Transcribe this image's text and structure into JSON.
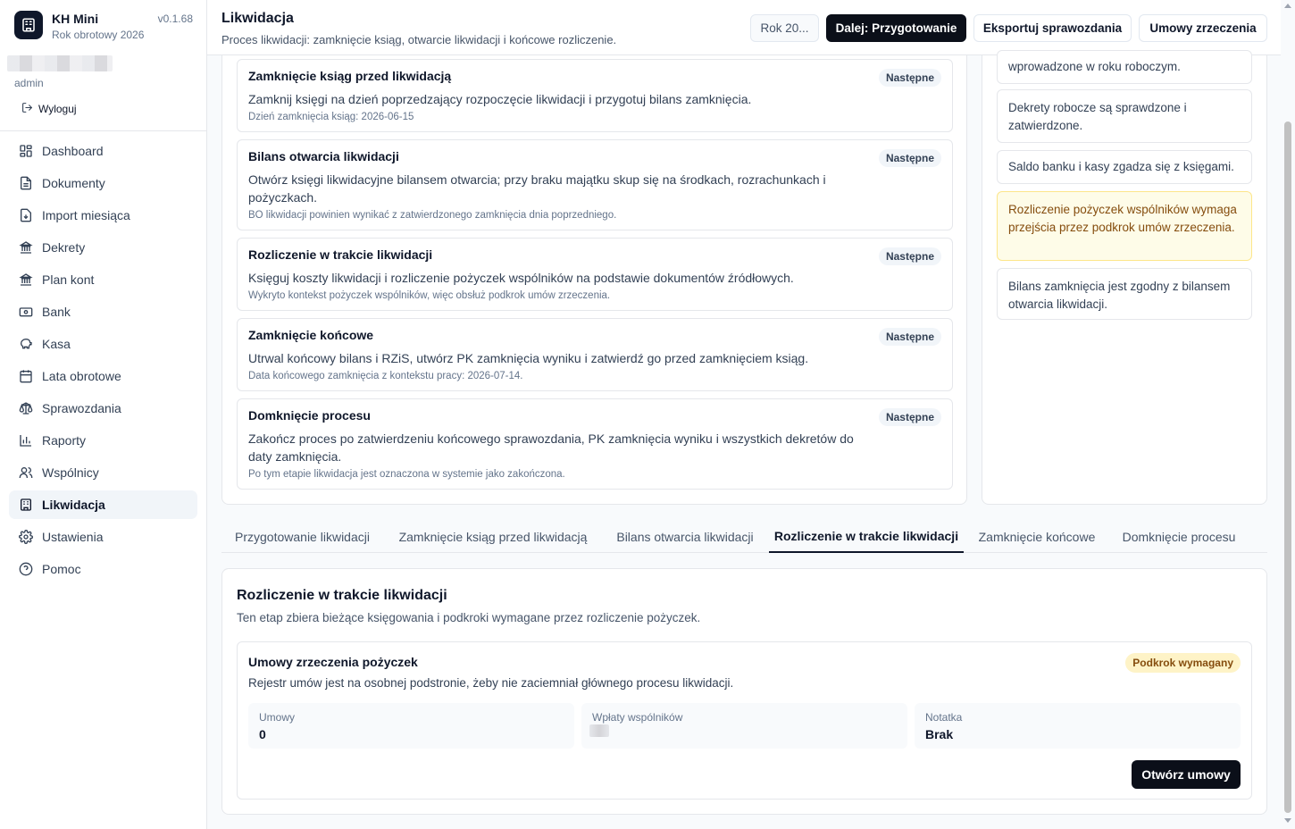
{
  "app": {
    "name": "KH Mini",
    "version": "v0.1.68",
    "fiscal_year": "Rok obrotowy 2026",
    "user_role": "admin",
    "logout_label": "Wyloguj"
  },
  "sidebar": {
    "items": [
      {
        "label": "Dashboard",
        "icon": "dashboard-icon"
      },
      {
        "label": "Dokumenty",
        "icon": "document-icon"
      },
      {
        "label": "Import miesiąca",
        "icon": "import-icon"
      },
      {
        "label": "Dekrety",
        "icon": "bank-building-icon"
      },
      {
        "label": "Plan kont",
        "icon": "bank-building-icon"
      },
      {
        "label": "Bank",
        "icon": "wallet-icon"
      },
      {
        "label": "Kasa",
        "icon": "piggy-bank-icon"
      },
      {
        "label": "Lata obrotowe",
        "icon": "calendar-icon"
      },
      {
        "label": "Sprawozdania",
        "icon": "scale-icon"
      },
      {
        "label": "Raporty",
        "icon": "bar-chart-icon"
      },
      {
        "label": "Wspólnicy",
        "icon": "users-icon"
      },
      {
        "label": "Likwidacja",
        "icon": "building-icon",
        "active": true
      },
      {
        "label": "Ustawienia",
        "icon": "gear-icon"
      },
      {
        "label": "Pomoc",
        "icon": "help-icon"
      }
    ]
  },
  "header": {
    "title": "Likwidacja",
    "subtitle": "Proces likwidacji: zamknięcie ksiąg, otwarcie likwidacji i końcowe rozliczenie.",
    "year_button": "Rok 20...",
    "next_button": "Dalej: Przygotowanie",
    "export_button": "Eksportuj sprawozdania",
    "agreements_button": "Umowy zrzeczenia"
  },
  "steps": [
    {
      "title": "Zamknięcie ksiąg przed likwidacją",
      "badge": "Następne",
      "desc": "Zamknij księgi na dzień poprzedzający rozpoczęcie likwidacji i przygotuj bilans zamknięcia.",
      "note": "Dzień zamknięcia ksiąg: 2026-06-15"
    },
    {
      "title": "Bilans otwarcia likwidacji",
      "badge": "Następne",
      "desc": "Otwórz księgi likwidacyjne bilansem otwarcia; przy braku majątku skup się na środkach, rozrachunkach i pożyczkach.",
      "note": "BO likwidacji powinien wynikać z zatwierdzonego zamknięcia dnia poprzedniego."
    },
    {
      "title": "Rozliczenie w trakcie likwidacji",
      "badge": "Następne",
      "desc": "Księguj koszty likwidacji i rozliczenie pożyczek wspólników na podstawie dokumentów źródłowych.",
      "note": "Wykryto kontekst pożyczek wspólników, więc obsłuż podkrok umów zrzeczenia."
    },
    {
      "title": "Zamknięcie końcowe",
      "badge": "Następne",
      "desc": "Utrwal końcowy bilans i RZiS, utwórz PK zamknięcia wyniku i zatwierdź go przed zamknięciem ksiąg.",
      "note": "Data końcowego zamknięcia z kontekstu pracy: 2026-07-14."
    },
    {
      "title": "Domknięcie procesu",
      "badge": "Następne",
      "desc": "Zakończ proces po zatwierdzeniu końcowego sprawozdania, PK zamknięcia wyniku i wszystkich dekretów do daty zamknięcia.",
      "note": "Po tym etapie likwidacja jest oznaczona w systemie jako zakończona."
    }
  ],
  "checks": [
    {
      "text": "wprowadzone w roku roboczym."
    },
    {
      "text": "Dekrety robocze są sprawdzone i zatwierdzone."
    },
    {
      "text": "Saldo banku i kasy zgadza się z księgami."
    },
    {
      "text": "Rozliczenie pożyczek wspólników wymaga przejścia przez podkrok umów zrzeczenia.",
      "warning": true
    },
    {
      "text": "Bilans zamknięcia jest zgodny z bilansem otwarcia likwidacji."
    }
  ],
  "tabs": [
    {
      "label": "Przygotowanie likwidacji"
    },
    {
      "label": "Zamknięcie ksiąg przed likwidacją"
    },
    {
      "label": "Bilans otwarcia likwidacji"
    },
    {
      "label": "Rozliczenie w trakcie likwidacji",
      "active": true
    },
    {
      "label": "Zamknięcie końcowe"
    },
    {
      "label": "Domknięcie procesu"
    }
  ],
  "detail": {
    "title": "Rozliczenie w trakcie likwidacji",
    "subtitle": "Ten etap zbiera bieżące księgowania i podkroki wymagane przez rozliczenie pożyczek.",
    "subcard": {
      "title": "Umowy zrzeczenia pożyczek",
      "badge": "Podkrok wymagany",
      "desc": "Rejestr umów jest na osobnej podstronie, żeby nie zaciemniał głównego procesu likwidacji.",
      "stats": [
        {
          "label": "Umowy",
          "value": "0"
        },
        {
          "label": "Wpłaty wspólników",
          "value": ""
        },
        {
          "label": "Notatka",
          "value": "Brak"
        }
      ],
      "open_button": "Otwórz umowy"
    }
  },
  "colors": {
    "primary": "#0b0f19",
    "warning_bg": "#fefce8",
    "warning_text": "#854d0e"
  }
}
